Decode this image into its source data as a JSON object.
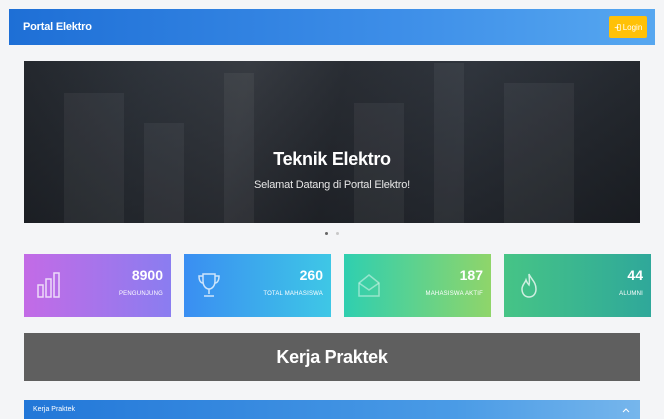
{
  "navbar": {
    "brand": "Portal Elektro",
    "login_label": "Login"
  },
  "hero": {
    "title": "Teknik Elektro",
    "subtitle": "Selamat Datang di Portal Elektro!",
    "slides_total": 2,
    "active_slide": 1
  },
  "stats": [
    {
      "value": "8900",
      "label": "PENGUNJUNG",
      "icon": "bar-chart-icon"
    },
    {
      "value": "260",
      "label": "TOTAL MAHASISWA",
      "icon": "trophy-icon"
    },
    {
      "value": "187",
      "label": "MAHASISWA AKTIF",
      "icon": "envelope-icon"
    },
    {
      "value": "44",
      "label": "ALUMNI",
      "icon": "flame-icon"
    }
  ],
  "banner": {
    "title": "Kerja Praktek"
  },
  "section": {
    "title": "Kerja Praktek",
    "icon": "chevron-up-icon"
  },
  "colors": {
    "navbar": "#1e6fd6",
    "login_button": "#ffc107",
    "banner": "#5f5f5f"
  }
}
